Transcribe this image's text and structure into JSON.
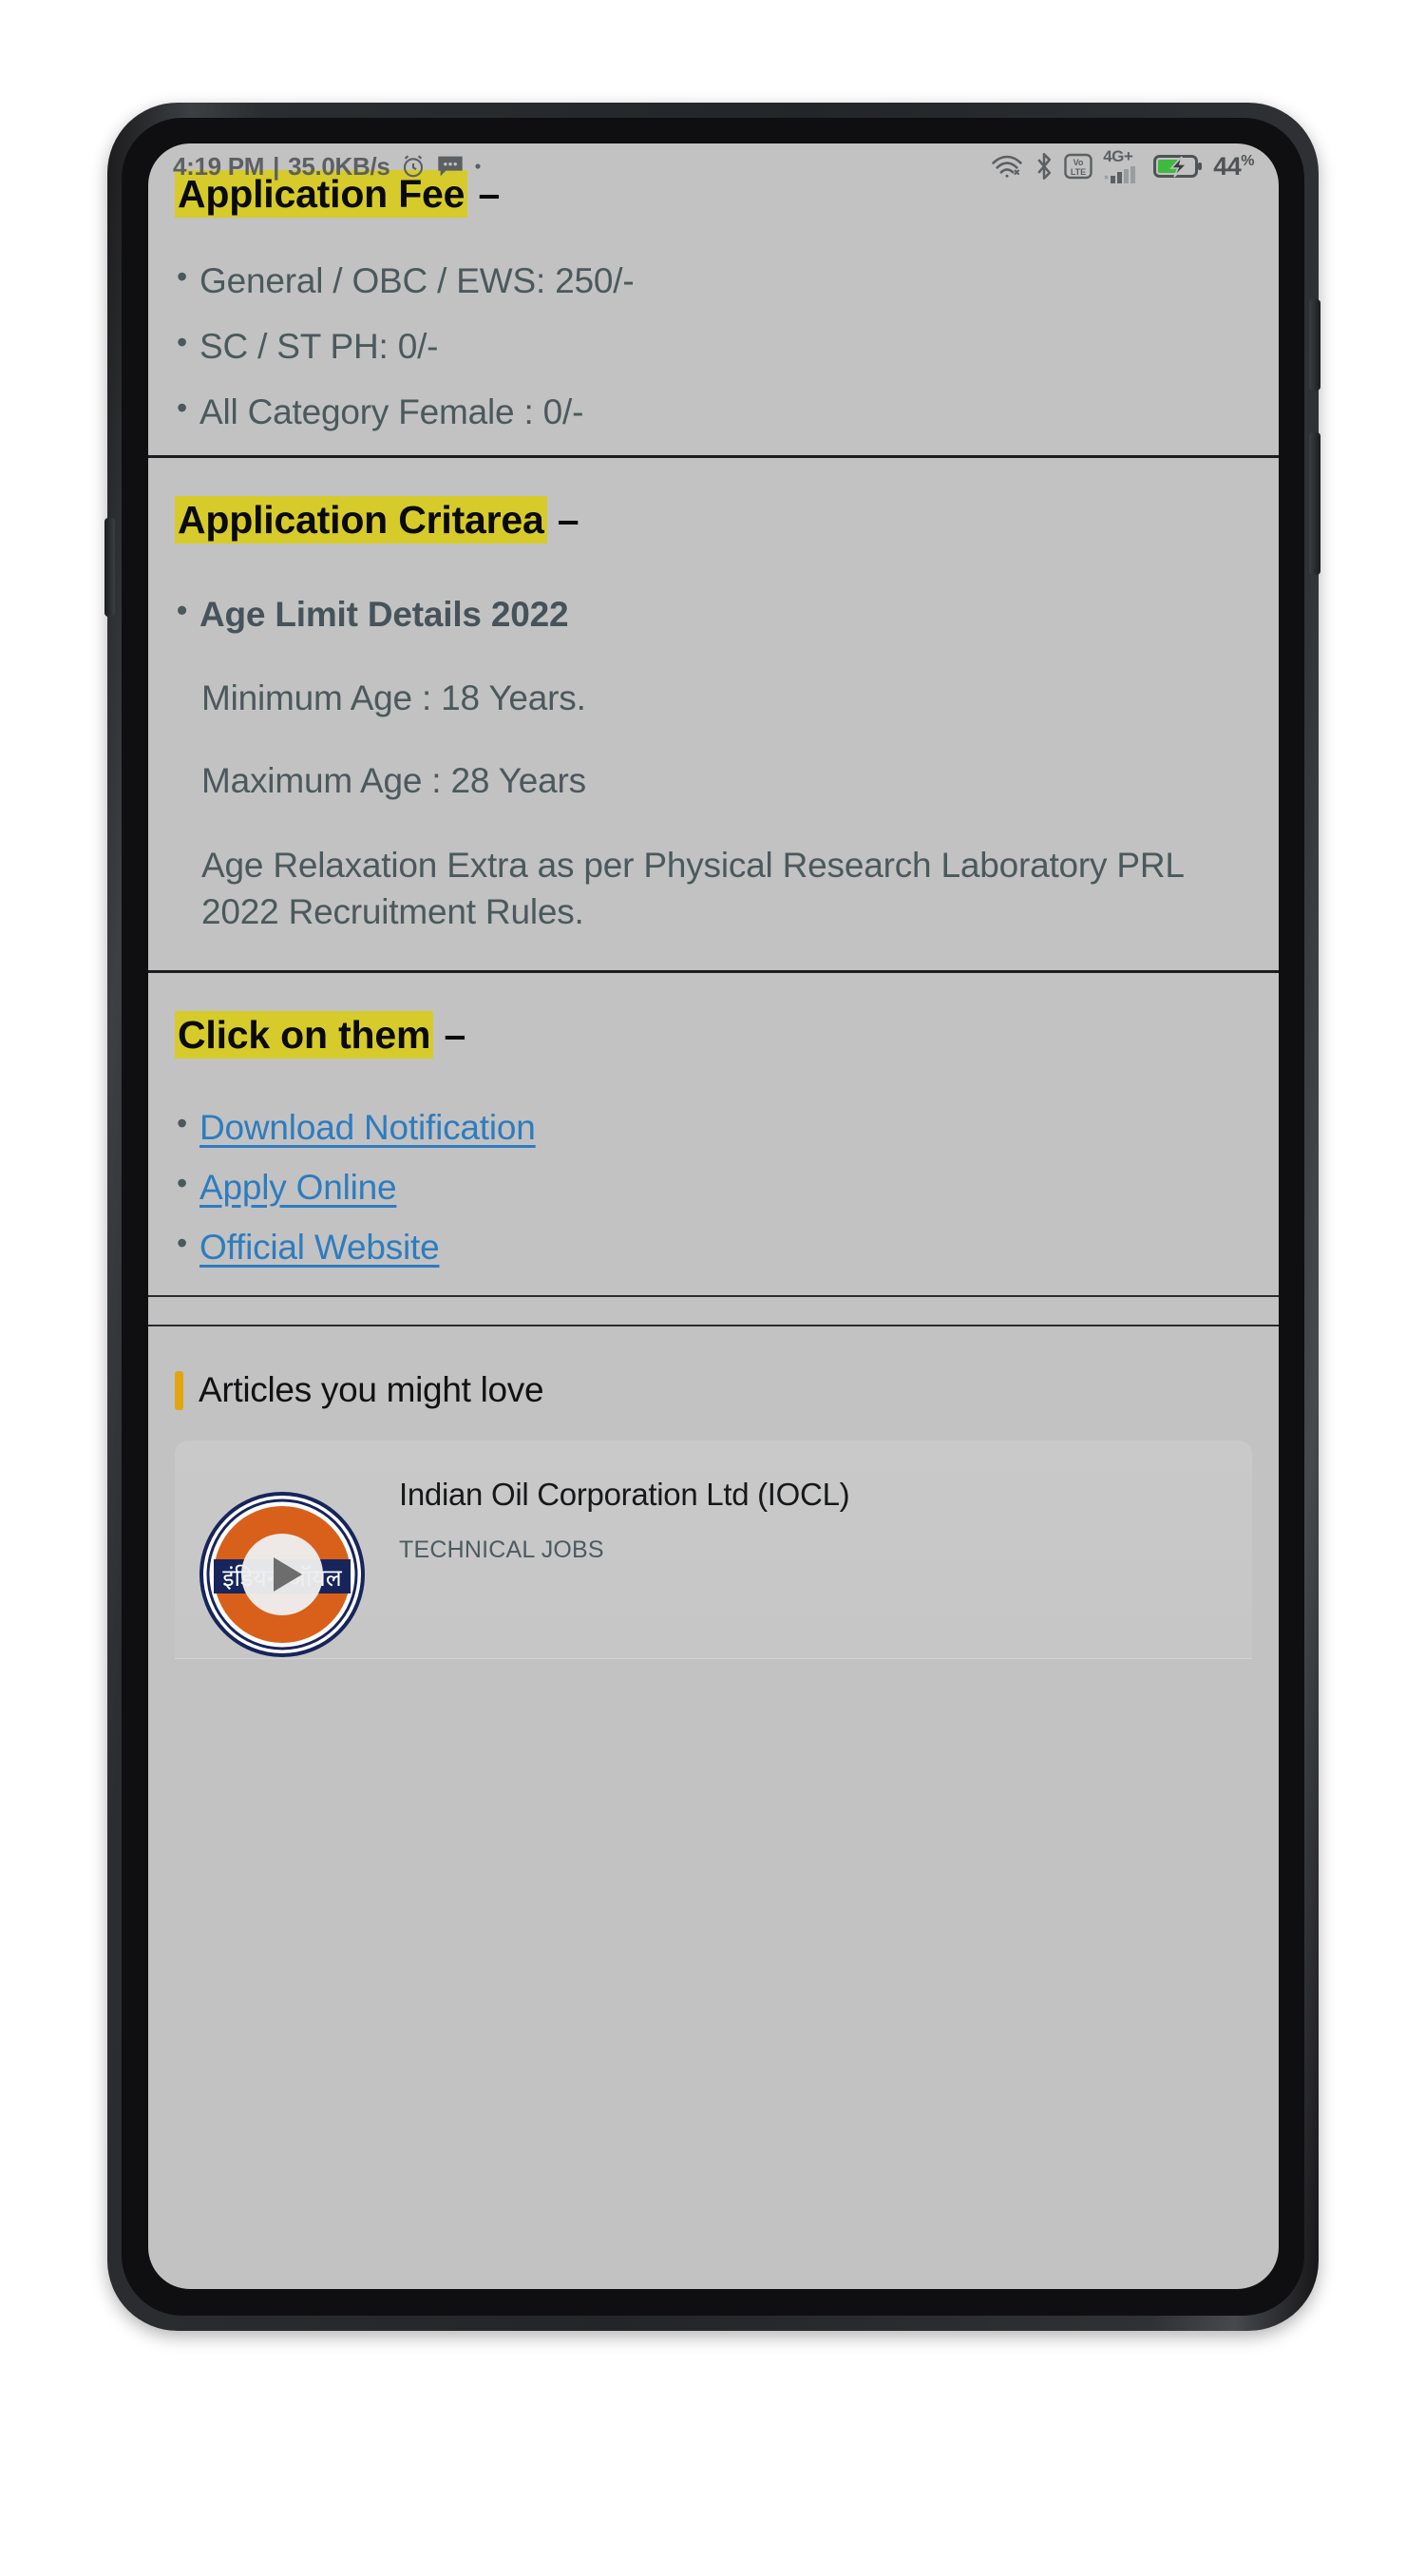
{
  "status_bar": {
    "time": "4:19 PM",
    "separator": "|",
    "network_speed": "35.0KB/s",
    "icons_left": [
      "alarm-clock-icon",
      "message-icon",
      "dot-icon"
    ],
    "icons_right": [
      "wifi-icon",
      "bluetooth-icon",
      "volte-icon",
      "signal-icon",
      "battery-charging-icon"
    ],
    "volte_label_top": "Vo",
    "volte_label_bottom": "LTE",
    "network_type": "4G+",
    "battery_percent": "44",
    "battery_percent_symbol": "%"
  },
  "colors": {
    "highlight_yellow": "#d6cb2a",
    "link_blue": "#2d7cc0",
    "body_text": "#4c595c",
    "accent_orange": "#e2a510",
    "screen_bg": "#c2c2c2",
    "logo_orange": "#d9601a",
    "logo_navy": "#1b2a5e"
  },
  "sections": {
    "application_fee": {
      "heading": "Application Fee",
      "heading_dash": "–",
      "items": [
        "General / OBC / EWS: 250/-",
        "SC / ST PH: 0/-",
        "All Category Female : 0/-"
      ]
    },
    "application_criteria": {
      "heading": "Application Critarea",
      "heading_dash": "–",
      "age_limit_title": "Age Limit Details 2022",
      "minimum_age": "Minimum Age : 18 Years.",
      "maximum_age": "Maximum Age : 28 Years",
      "age_relaxation": "Age Relaxation Extra as per Physical Research Laboratory PRL 2022 Recruitment Rules."
    },
    "click_on_them": {
      "heading": "Click on them",
      "heading_dash": "–",
      "links": [
        "Download Notification",
        "Apply Online",
        "Official Website"
      ]
    },
    "articles": {
      "title": "Articles you might love",
      "cards": [
        {
          "title": "Indian Oil Corporation Ltd (IOCL)",
          "category": "TECHNICAL JOBS",
          "thumbnail_icon": "iocl-logo-icon",
          "logo_text": "इंडियन ऑयल",
          "play_overlay": "play-icon"
        }
      ]
    }
  }
}
